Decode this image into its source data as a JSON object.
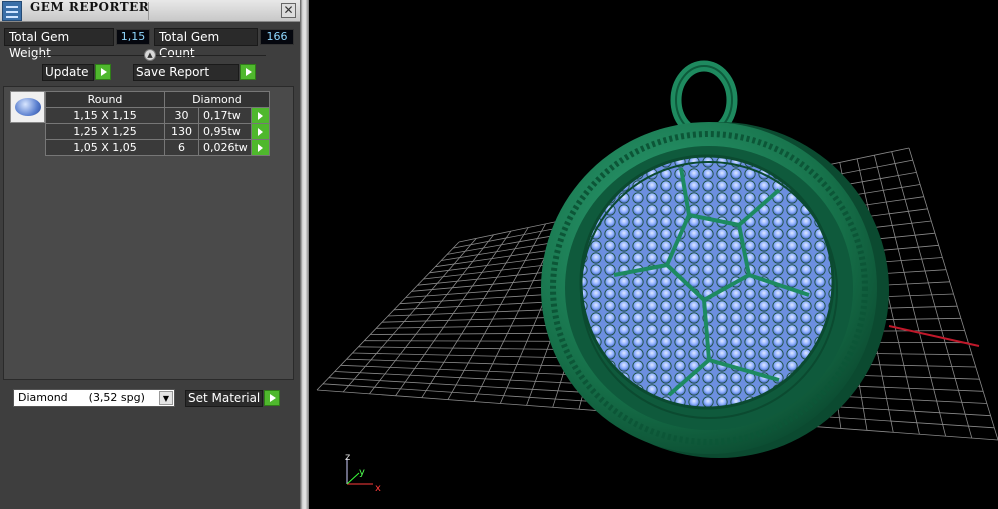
{
  "window": {
    "title": "GEM REPORTER",
    "close_glyph": "✕"
  },
  "stats": {
    "weight_label": "Total Gem Weight",
    "weight_value": "1,15",
    "count_label": "Total Gem Count",
    "count_value": "166"
  },
  "actions": {
    "update_label": "Update",
    "save_label": "Save Report"
  },
  "table": {
    "headers": [
      "Round",
      "Diamond"
    ],
    "rows": [
      {
        "size": "1,15 X 1,15",
        "count": "30",
        "weight": "0,17tw"
      },
      {
        "size": "1,25 X 1,25",
        "count": "130",
        "weight": "0,95tw"
      },
      {
        "size": "1,05 X 1,05",
        "count": "6",
        "weight": "0,026tw"
      }
    ]
  },
  "material": {
    "selected": "Diamond      (3,52 spg)",
    "set_label": "Set Material"
  },
  "axes": {
    "z": "z",
    "y": "y",
    "x": "x"
  },
  "colors": {
    "accent_green": "#4fb82d",
    "metal": "#1c7a55",
    "gem": "#8fb0ff",
    "grid": "#8a8a8a"
  }
}
